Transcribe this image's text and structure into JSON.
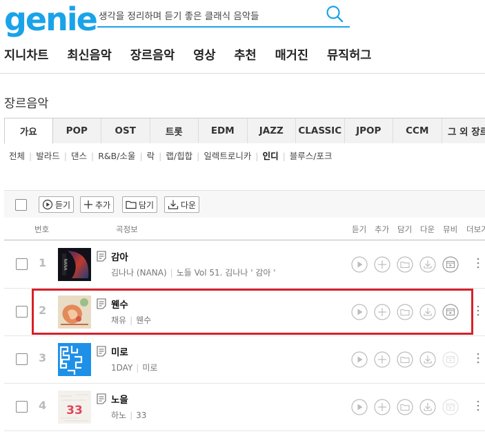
{
  "logo": "genie",
  "search": {
    "value": "생각을 정리하며 듣기 좋은 클래식 음악들",
    "placeholder": ""
  },
  "gnb": [
    "지니차트",
    "최신음악",
    "장르음악",
    "영상",
    "추천",
    "매거진",
    "뮤직허그"
  ],
  "page_title": "장르음악",
  "genre_tabs": [
    "가요",
    "POP",
    "OST",
    "트롯",
    "EDM",
    "JAZZ",
    "CLASSIC",
    "JPOP",
    "CCM",
    "그 외 장르"
  ],
  "active_tab": "가요",
  "subgenres": [
    "전체",
    "발라드",
    "댄스",
    "R&B/소울",
    "락",
    "랩/힙합",
    "일렉트로니카",
    "인디",
    "블루스/포크"
  ],
  "active_subgenre": "인디",
  "toolbar": {
    "play": "듣기",
    "add": "추가",
    "save": "담기",
    "download": "다운"
  },
  "columns": {
    "no": "번호",
    "info": "곡정보",
    "listen": "듣기",
    "add": "추가",
    "save": "담기",
    "download": "다운",
    "video": "뮤비",
    "more": "더보기"
  },
  "songs": [
    {
      "rank": "1",
      "title": "감아",
      "artist": "김나나 (NANA)",
      "album": "노들 Vol 51. 김나나 ' 감아 '",
      "video_available": true
    },
    {
      "rank": "2",
      "title": "웬수",
      "artist": "채유",
      "album": "웬수",
      "video_available": true
    },
    {
      "rank": "3",
      "title": "미로",
      "artist": "1DAY",
      "album": "미로",
      "video_available": false
    },
    {
      "rank": "4",
      "title": "노을",
      "artist": "하노",
      "album": "33",
      "video_available": false
    }
  ],
  "colors": {
    "brand": "#1aa3e8",
    "highlight": "#d7202a"
  }
}
